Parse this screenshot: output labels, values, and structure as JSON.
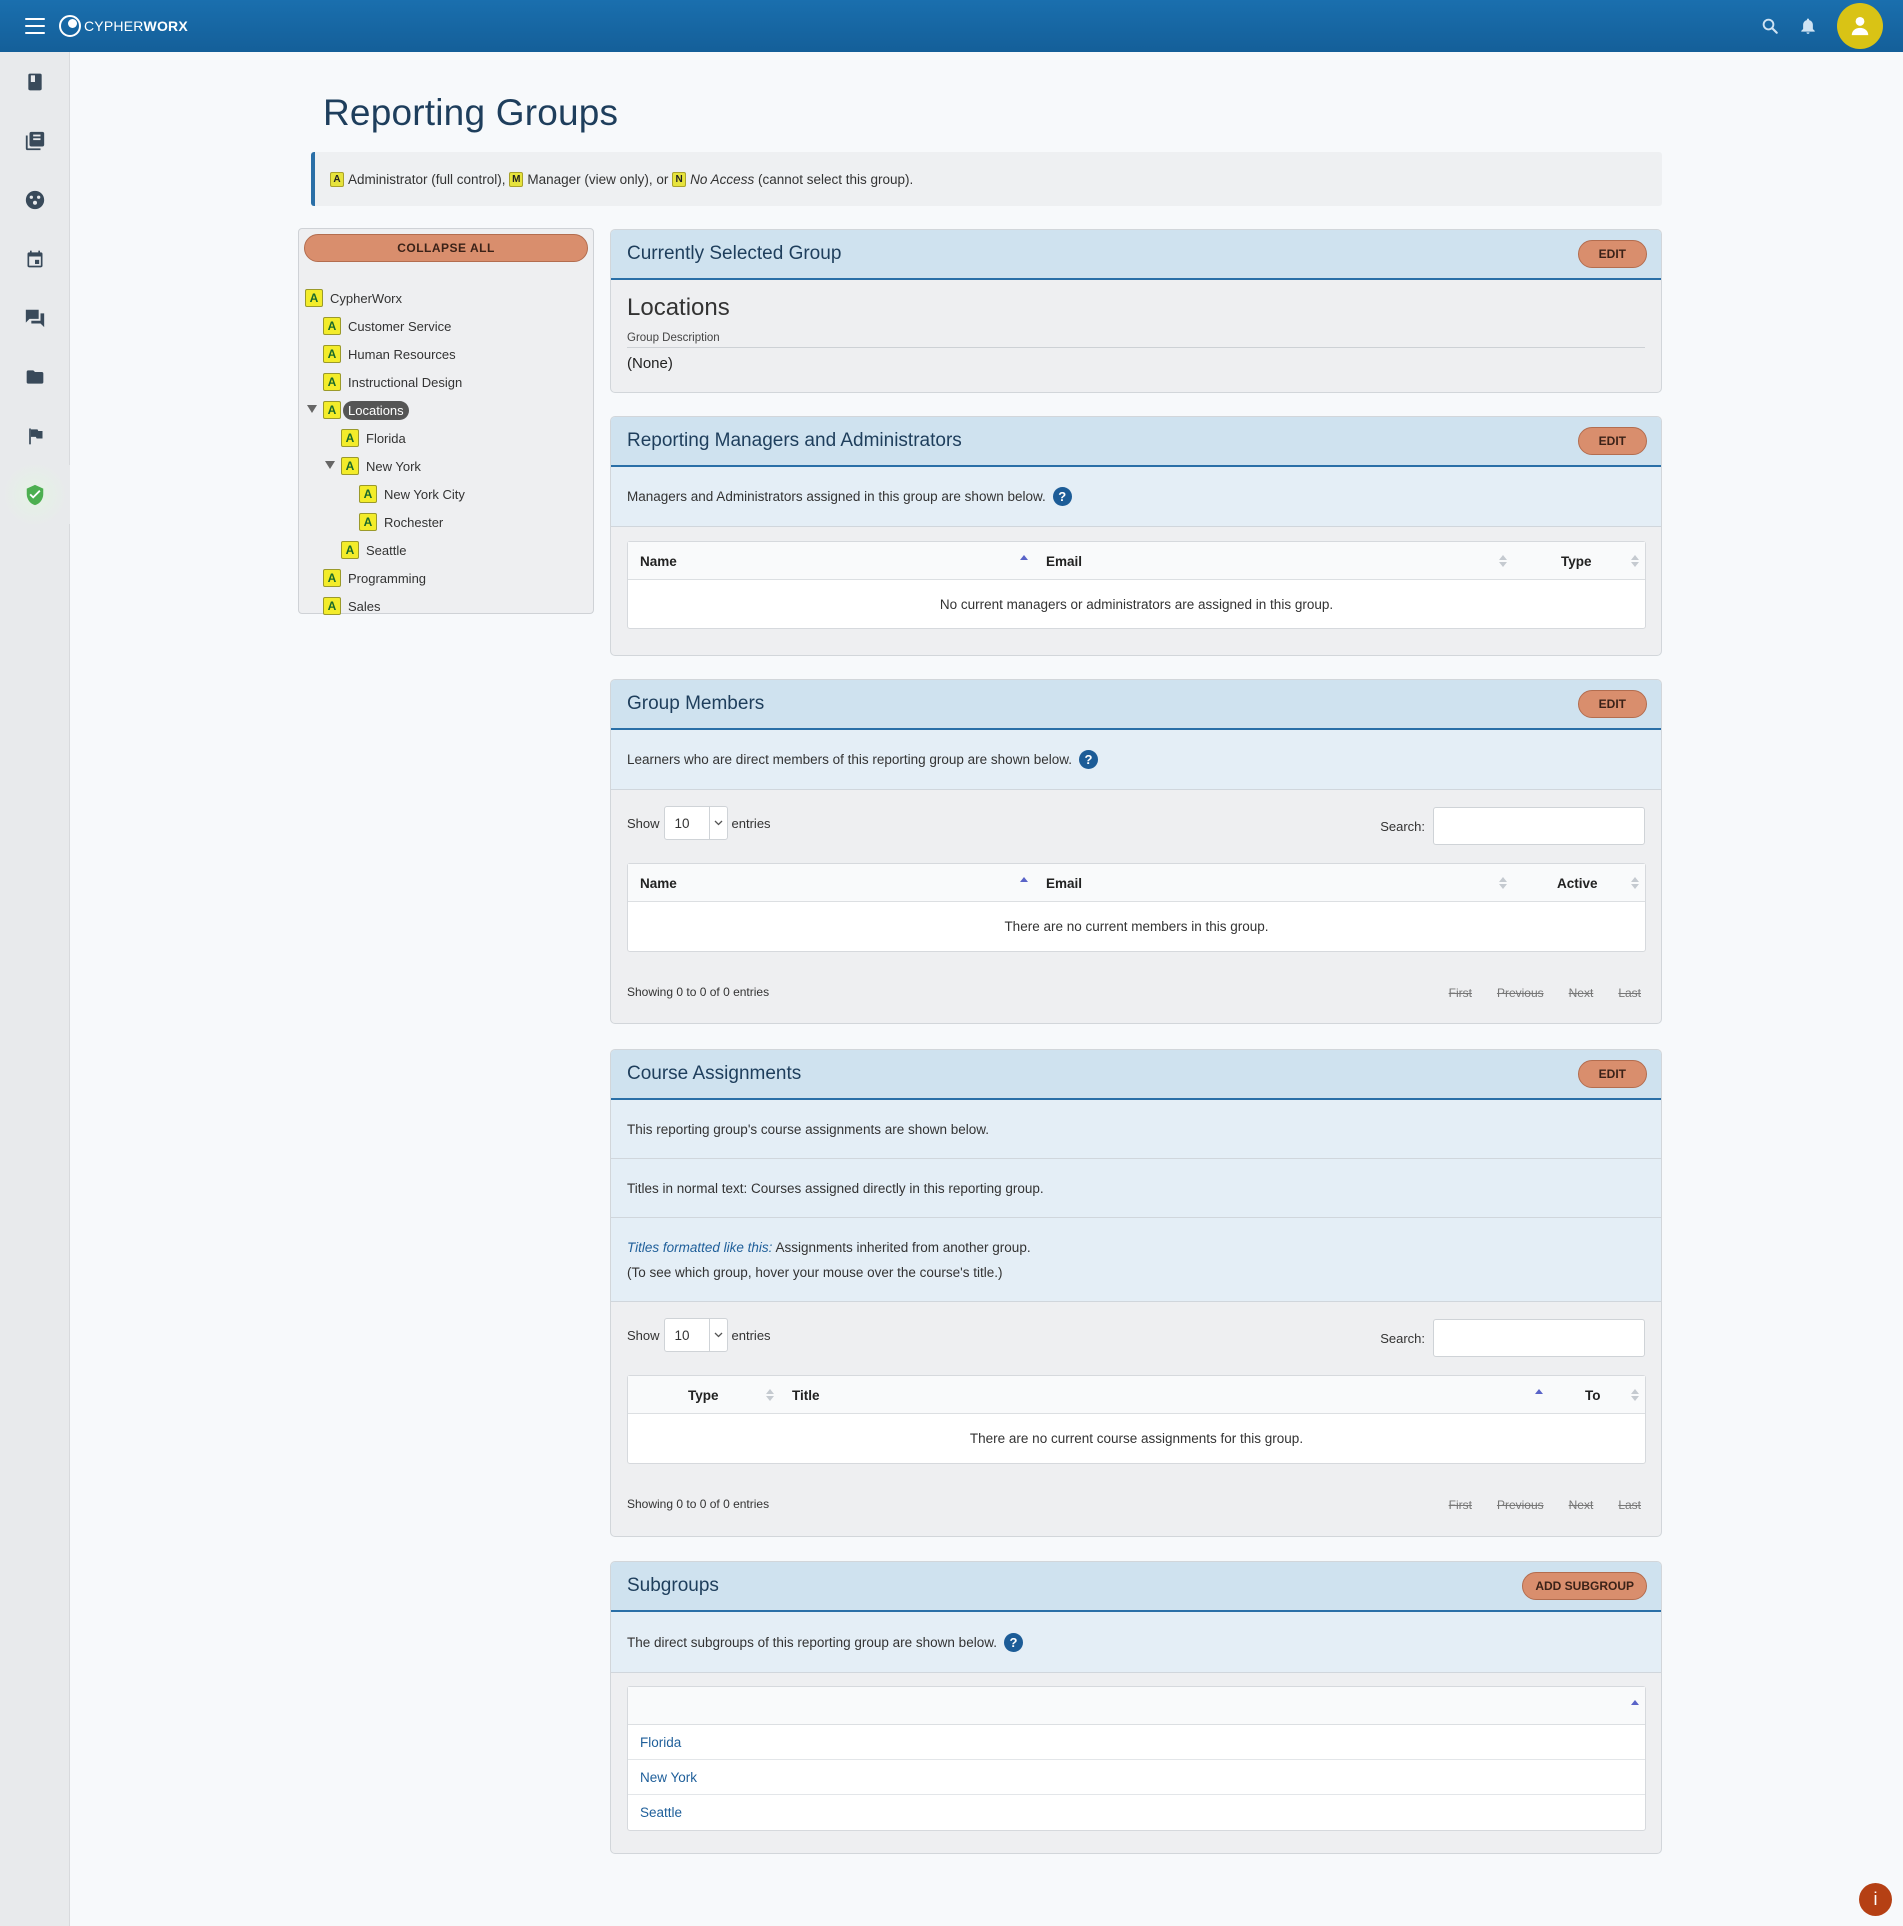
{
  "app": {
    "logo_light": "CYPHER",
    "logo_bold": "WORX"
  },
  "topbar": {
    "search_icon": "search-icon",
    "bell_icon": "bell-icon",
    "avatar_icon": "user-icon"
  },
  "rail": [
    "book-icon",
    "library-icon",
    "palette-icon",
    "calendar-icon",
    "forum-icon",
    "folder-icon",
    "flag-icon",
    "shield-check-icon"
  ],
  "page": {
    "title": "Reporting Groups"
  },
  "legend": {
    "admin_badge": "A",
    "admin_label": "Administrator",
    "admin_desc": " (full control),",
    "manager_badge": "M",
    "manager_label": "Manager",
    "manager_desc": " (view only), or",
    "noaccess_badge": "N",
    "noaccess_label": "No Access",
    "noaccess_desc": " (cannot select this group)."
  },
  "tree": {
    "collapse_label": "COLLAPSE ALL",
    "badge": "A",
    "items": [
      {
        "label": "CypherWorx"
      },
      {
        "label": "Customer Service"
      },
      {
        "label": "Human Resources"
      },
      {
        "label": "Instructional Design"
      },
      {
        "label": "Locations"
      },
      {
        "label": "Florida"
      },
      {
        "label": "New York"
      },
      {
        "label": "New York City"
      },
      {
        "label": "Rochester"
      },
      {
        "label": "Seattle"
      },
      {
        "label": "Programming"
      },
      {
        "label": "Sales"
      }
    ]
  },
  "selected": {
    "header": "Currently Selected Group",
    "edit": "EDIT",
    "name": "Locations",
    "desc_label": "Group Description",
    "desc_value": "(None)"
  },
  "managers": {
    "header": "Reporting Managers and Administrators",
    "edit": "EDIT",
    "info": "Managers and Administrators assigned in this group are shown below.",
    "help": "?",
    "cols": {
      "name": "Name",
      "email": "Email",
      "type": "Type"
    },
    "empty": "No current managers or administrators are assigned in this group."
  },
  "members": {
    "header": "Group Members",
    "edit": "EDIT",
    "info": "Learners who are direct members of this reporting group are shown below.",
    "help": "?",
    "show": "Show",
    "entries_value": "10",
    "entries": "entries",
    "search_label": "Search:",
    "cols": {
      "name": "Name",
      "email": "Email",
      "active": "Active"
    },
    "empty": "There are no current members in this group.",
    "showing": "Showing 0 to 0 of 0 entries",
    "pager": {
      "first": "First",
      "previous": "Previous",
      "next": "Next",
      "last": "Last"
    }
  },
  "courses": {
    "header": "Course Assignments",
    "edit": "EDIT",
    "info1": "This reporting group's course assignments are shown below.",
    "info2": "Titles in normal text: Courses assigned directly in this reporting group.",
    "info3_em": "Titles formatted like this:",
    "info3_rest": " Assignments inherited from another group.",
    "info4": "(To see which group, hover your mouse over the course's title.)",
    "show": "Show",
    "entries_value": "10",
    "entries": "entries",
    "search_label": "Search:",
    "cols": {
      "type": "Type",
      "title": "Title",
      "to": "To"
    },
    "empty": "There are no current course assignments for this group.",
    "showing": "Showing 0 to 0 of 0 entries",
    "pager": {
      "first": "First",
      "previous": "Previous",
      "next": "Next",
      "last": "Last"
    }
  },
  "subgroups": {
    "header": "Subgroups",
    "add": "ADD SUBGROUP",
    "info": "The direct subgroups of this reporting group are shown below.",
    "help": "?",
    "items": [
      "Florida",
      "New York",
      "Seattle"
    ]
  },
  "fab": {
    "label": "i"
  }
}
